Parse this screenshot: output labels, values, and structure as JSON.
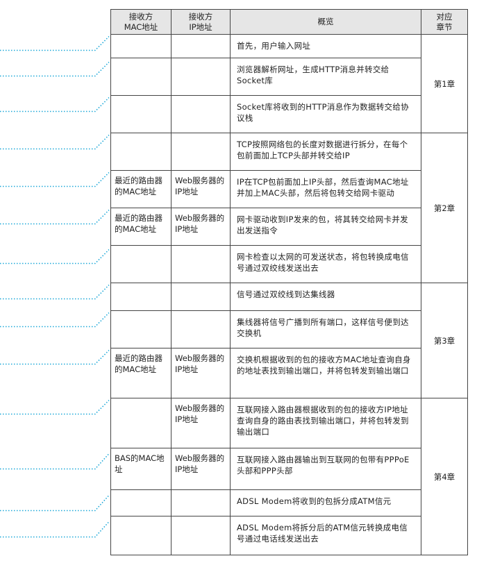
{
  "header": {
    "col1": "接收方\nMAC地址",
    "col2": "接收方\nIP地址",
    "col3": "概览",
    "col4": "对应\n章节"
  },
  "rows": [
    {
      "mac": "",
      "ip": "",
      "summary": "首先，用户输入网址"
    },
    {
      "mac": "",
      "ip": "",
      "summary": "浏览器解析网址，生成HTTP消息并转交给Socket库"
    },
    {
      "mac": "",
      "ip": "",
      "summary": "Socket库将收到的HTTP消息作为数据转交给协议栈"
    },
    {
      "mac": "",
      "ip": "",
      "summary": "TCP按照网络包的长度对数据进行拆分，在每个包前面加上TCP头部并转交给IP"
    },
    {
      "mac": "最近的路由器的MAC地址",
      "ip": "Web服务器的IP地址",
      "summary": "IP在TCP包前面加上IP头部，然后查询MAC地址并加上MAC头部，然后将包转交给网卡驱动"
    },
    {
      "mac": "最近的路由器的MAC地址",
      "ip": "Web服务器的IP地址",
      "summary": "网卡驱动收到IP发来的包，将其转交给网卡并发出发送指令"
    },
    {
      "mac": "",
      "ip": "",
      "summary": "网卡检查以太网的可发送状态，将包转换成电信号通过双绞线发送出去"
    },
    {
      "mac": "",
      "ip": "",
      "summary": "信号通过双绞线到达集线器"
    },
    {
      "mac": "",
      "ip": "",
      "summary": "集线器将信号广播到所有端口，这样信号便到达交换机"
    },
    {
      "mac": "最近的路由器的MAC地址",
      "ip": "Web服务器的IP地址",
      "summary": "交换机根据收到的包的接收方MAC地址查询自身的地址表找到输出端口，并将包转发到输出端口"
    },
    {
      "mac": "",
      "ip": "Web服务器的IP地址",
      "summary": "互联网接入路由器根据收到的包的接收方IP地址查询自身的路由表找到输出端口，并将包转发到输出端口"
    },
    {
      "mac": "BAS的MAC地址",
      "ip": "Web服务器的IP地址",
      "summary": "互联网接入路由器输出到互联网的包带有PPPoE头部和PPP头部"
    },
    {
      "mac": "",
      "ip": "",
      "summary": "ADSL Modem将收到的包拆分成ATM信元"
    },
    {
      "mac": "",
      "ip": "",
      "summary": "ADSL Modem将拆分后的ATM信元转换成电信号通过电话线发送出去"
    }
  ],
  "chapters": [
    "第1章",
    "第2章",
    "第3章",
    "第4章"
  ],
  "colors": {
    "leader": "#1aa7d8",
    "header_bg": "#e6e6e6",
    "border": "#444444"
  }
}
